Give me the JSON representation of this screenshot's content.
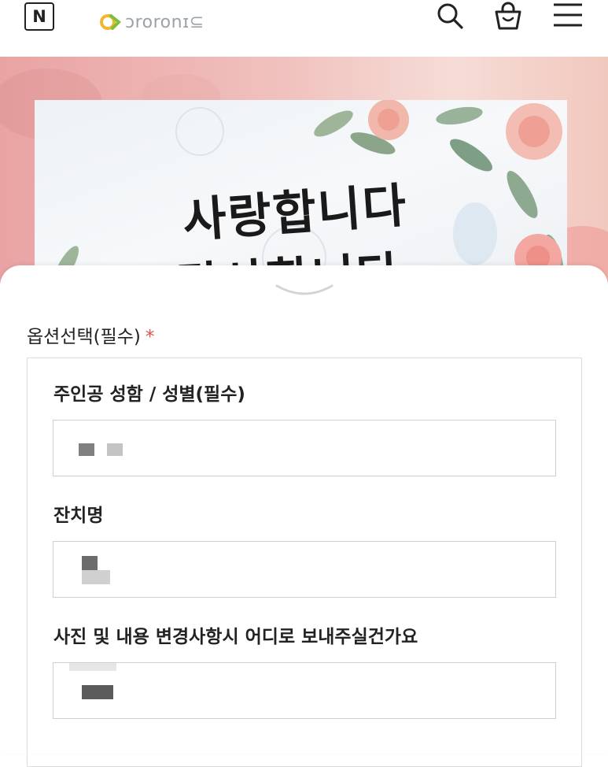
{
  "header": {
    "badge": "N",
    "logo_text": "ɔroronɪ⊆",
    "icons": [
      "search-icon",
      "shopping-bag-icon",
      "menu-icon"
    ]
  },
  "hero": {
    "line1": "사랑합니다",
    "line2": "감사합니다"
  },
  "option": {
    "title": "옵션선택(필수)",
    "required_mark": "*",
    "fields": [
      {
        "label": "주인공 성함 / 성별(필수)"
      },
      {
        "label": "잔치명"
      },
      {
        "label": "사진 및 내용 변경사항시 어디로 보내주실건가요"
      }
    ]
  },
  "colors": {
    "required": "#d9534f",
    "hero_pink": "#e9a3a3",
    "logo_green": "#7cbf3a"
  }
}
